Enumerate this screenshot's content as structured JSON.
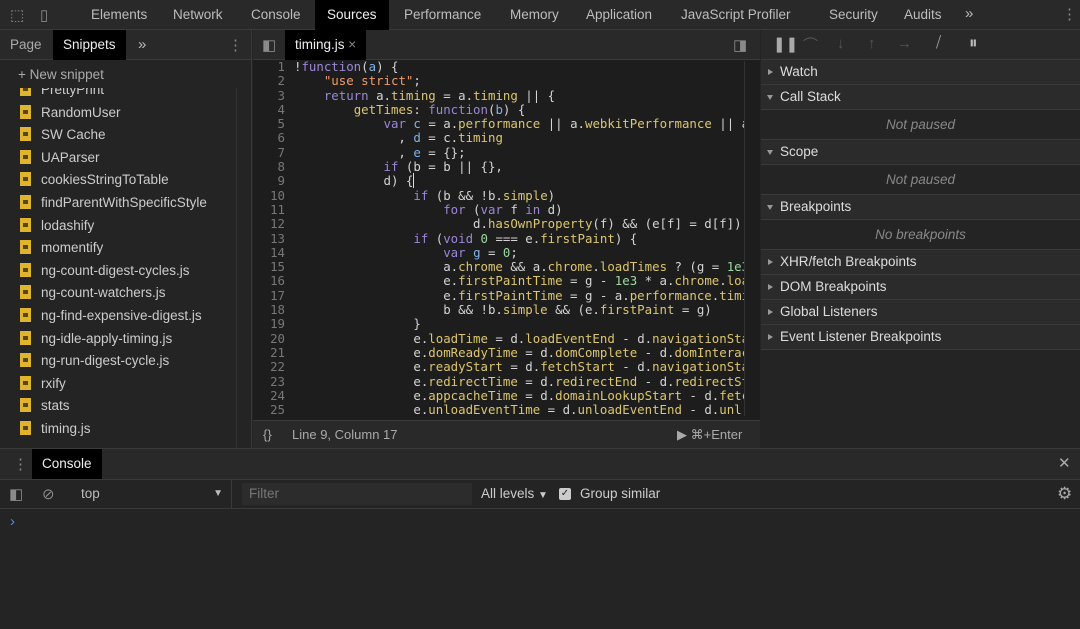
{
  "panel_tabs": [
    "Elements",
    "Network",
    "Console",
    "Sources",
    "Performance",
    "Memory",
    "Application",
    "JavaScript Profiler",
    "Security",
    "Audits"
  ],
  "active_panel": "Sources",
  "navigator": {
    "tabs": [
      "Page",
      "Snippets"
    ],
    "active": "Snippets",
    "new_snippet": "New snippet",
    "snippets": [
      "PrettyPrint",
      "RandomUser",
      "SW Cache",
      "UAParser",
      "cookiesStringToTable",
      "findParentWithSpecificStyle",
      "lodashify",
      "momentify",
      "ng-count-digest-cycles.js",
      "ng-count-watchers.js",
      "ng-find-expensive-digest.js",
      "ng-idle-apply-timing.js",
      "ng-run-digest-cycle.js",
      "rxify",
      "stats",
      "timing.js"
    ]
  },
  "editor": {
    "file_tab": "timing.js",
    "status": "Line 9, Column 17",
    "run": "⌘+Enter",
    "format_label": "{}",
    "lines": [
      [
        [
          "p",
          "!"
        ],
        [
          "k",
          "function"
        ],
        [
          "p",
          "("
        ],
        [
          "v",
          "a"
        ],
        [
          "p",
          ") {"
        ]
      ],
      [
        [
          "p",
          "    "
        ],
        [
          "s",
          "\"use strict\""
        ],
        [
          "p",
          ";"
        ]
      ],
      [
        [
          "p",
          "    "
        ],
        [
          "k",
          "return"
        ],
        [
          "p",
          " a."
        ],
        [
          "y",
          "timing"
        ],
        [
          "p",
          " = a."
        ],
        [
          "y",
          "timing"
        ],
        [
          "p",
          " || {"
        ]
      ],
      [
        [
          "p",
          "        "
        ],
        [
          "y",
          "getTimes"
        ],
        [
          "p",
          ": "
        ],
        [
          "k",
          "function"
        ],
        [
          "p",
          "("
        ],
        [
          "v",
          "b"
        ],
        [
          "p",
          ") {"
        ]
      ],
      [
        [
          "p",
          "            "
        ],
        [
          "k",
          "var"
        ],
        [
          "p",
          " "
        ],
        [
          "v",
          "c"
        ],
        [
          "p",
          " = a."
        ],
        [
          "y",
          "performance"
        ],
        [
          "p",
          " || a."
        ],
        [
          "y",
          "webkitPerformance"
        ],
        [
          "p",
          " || a"
        ]
      ],
      [
        [
          "p",
          "              , "
        ],
        [
          "v",
          "d"
        ],
        [
          "p",
          " = c."
        ],
        [
          "y",
          "timing"
        ]
      ],
      [
        [
          "p",
          "              , "
        ],
        [
          "v",
          "e"
        ],
        [
          "p",
          " = {};"
        ]
      ],
      [
        [
          "p",
          "            "
        ],
        [
          "k",
          "if"
        ],
        [
          "p",
          " (b = b || {},"
        ]
      ],
      [
        [
          "p",
          "            d) {"
        ]
      ],
      [
        [
          "p",
          "                "
        ],
        [
          "k",
          "if"
        ],
        [
          "p",
          " (b && !b."
        ],
        [
          "y",
          "simple"
        ],
        [
          "p",
          ")"
        ]
      ],
      [
        [
          "p",
          "                    "
        ],
        [
          "k",
          "for"
        ],
        [
          "p",
          " ("
        ],
        [
          "k",
          "var"
        ],
        [
          "p",
          " f "
        ],
        [
          "k",
          "in"
        ],
        [
          "p",
          " d)"
        ]
      ],
      [
        [
          "p",
          "                        d."
        ],
        [
          "y",
          "hasOwnProperty"
        ],
        [
          "p",
          "(f) && (e[f] = d[f]);"
        ]
      ],
      [
        [
          "p",
          "                "
        ],
        [
          "k",
          "if"
        ],
        [
          "p",
          " ("
        ],
        [
          "k",
          "void"
        ],
        [
          "p",
          " "
        ],
        [
          "n",
          "0"
        ],
        [
          "p",
          " === e."
        ],
        [
          "y",
          "firstPaint"
        ],
        [
          "p",
          ") {"
        ]
      ],
      [
        [
          "p",
          "                    "
        ],
        [
          "k",
          "var"
        ],
        [
          "p",
          " "
        ],
        [
          "v",
          "g"
        ],
        [
          "p",
          " = "
        ],
        [
          "n",
          "0"
        ],
        [
          "p",
          ";"
        ]
      ],
      [
        [
          "p",
          "                    a."
        ],
        [
          "y",
          "chrome"
        ],
        [
          "p",
          " && a."
        ],
        [
          "y",
          "chrome"
        ],
        [
          "p",
          "."
        ],
        [
          "y",
          "loadTimes"
        ],
        [
          "p",
          " ? (g = "
        ],
        [
          "n",
          "1e3"
        ],
        [
          "p",
          " *"
        ]
      ],
      [
        [
          "p",
          "                    e."
        ],
        [
          "y",
          "firstPaintTime"
        ],
        [
          "p",
          " = g - "
        ],
        [
          "n",
          "1e3"
        ],
        [
          "p",
          " * a."
        ],
        [
          "y",
          "chrome"
        ],
        [
          "p",
          "."
        ],
        [
          "y",
          "loadT"
        ]
      ],
      [
        [
          "p",
          "                    e."
        ],
        [
          "y",
          "firstPaintTime"
        ],
        [
          "p",
          " = g - a."
        ],
        [
          "y",
          "performance"
        ],
        [
          "p",
          "."
        ],
        [
          "y",
          "timing"
        ]
      ],
      [
        [
          "p",
          "                    b && !b."
        ],
        [
          "y",
          "simple"
        ],
        [
          "p",
          " && (e."
        ],
        [
          "y",
          "firstPaint"
        ],
        [
          "p",
          " = g)"
        ]
      ],
      [
        [
          "p",
          "                }"
        ]
      ],
      [
        [
          "p",
          "                e."
        ],
        [
          "y",
          "loadTime"
        ],
        [
          "p",
          " = d."
        ],
        [
          "y",
          "loadEventEnd"
        ],
        [
          "p",
          " - d."
        ],
        [
          "y",
          "navigationStart"
        ]
      ],
      [
        [
          "p",
          "                e."
        ],
        [
          "y",
          "domReadyTime"
        ],
        [
          "p",
          " = d."
        ],
        [
          "y",
          "domComplete"
        ],
        [
          "p",
          " - d."
        ],
        [
          "y",
          "domInteracti"
        ]
      ],
      [
        [
          "p",
          "                e."
        ],
        [
          "y",
          "readyStart"
        ],
        [
          "p",
          " = d."
        ],
        [
          "y",
          "fetchStart"
        ],
        [
          "p",
          " - d."
        ],
        [
          "y",
          "navigationStart"
        ]
      ],
      [
        [
          "p",
          "                e."
        ],
        [
          "y",
          "redirectTime"
        ],
        [
          "p",
          " = d."
        ],
        [
          "y",
          "redirectEnd"
        ],
        [
          "p",
          " - d."
        ],
        [
          "y",
          "redirectStar"
        ]
      ],
      [
        [
          "p",
          "                e."
        ],
        [
          "y",
          "appcacheTime"
        ],
        [
          "p",
          " = d."
        ],
        [
          "y",
          "domainLookupStart"
        ],
        [
          "p",
          " - d."
        ],
        [
          "y",
          "fetchS"
        ]
      ],
      [
        [
          "p",
          "                e."
        ],
        [
          "y",
          "unloadEventTime"
        ],
        [
          "p",
          " = d."
        ],
        [
          "y",
          "unloadEventEnd"
        ],
        [
          "p",
          " - d."
        ],
        [
          "y",
          "unl"
        ]
      ]
    ]
  },
  "debugger": {
    "sections": [
      {
        "title": "Watch",
        "open": false
      },
      {
        "title": "Call Stack",
        "open": true,
        "body": "Not paused"
      },
      {
        "title": "Scope",
        "open": true,
        "body": "Not paused"
      },
      {
        "title": "Breakpoints",
        "open": true,
        "body": "No breakpoints"
      },
      {
        "title": "XHR/fetch Breakpoints",
        "open": false
      },
      {
        "title": "DOM Breakpoints",
        "open": false
      },
      {
        "title": "Global Listeners",
        "open": false
      },
      {
        "title": "Event Listener Breakpoints",
        "open": false
      }
    ]
  },
  "drawer": {
    "tab": "Console",
    "context": "top",
    "filter_placeholder": "Filter",
    "levels": "All levels",
    "group_similar": "Group similar",
    "group_similar_checked": true,
    "prompt": "›"
  }
}
